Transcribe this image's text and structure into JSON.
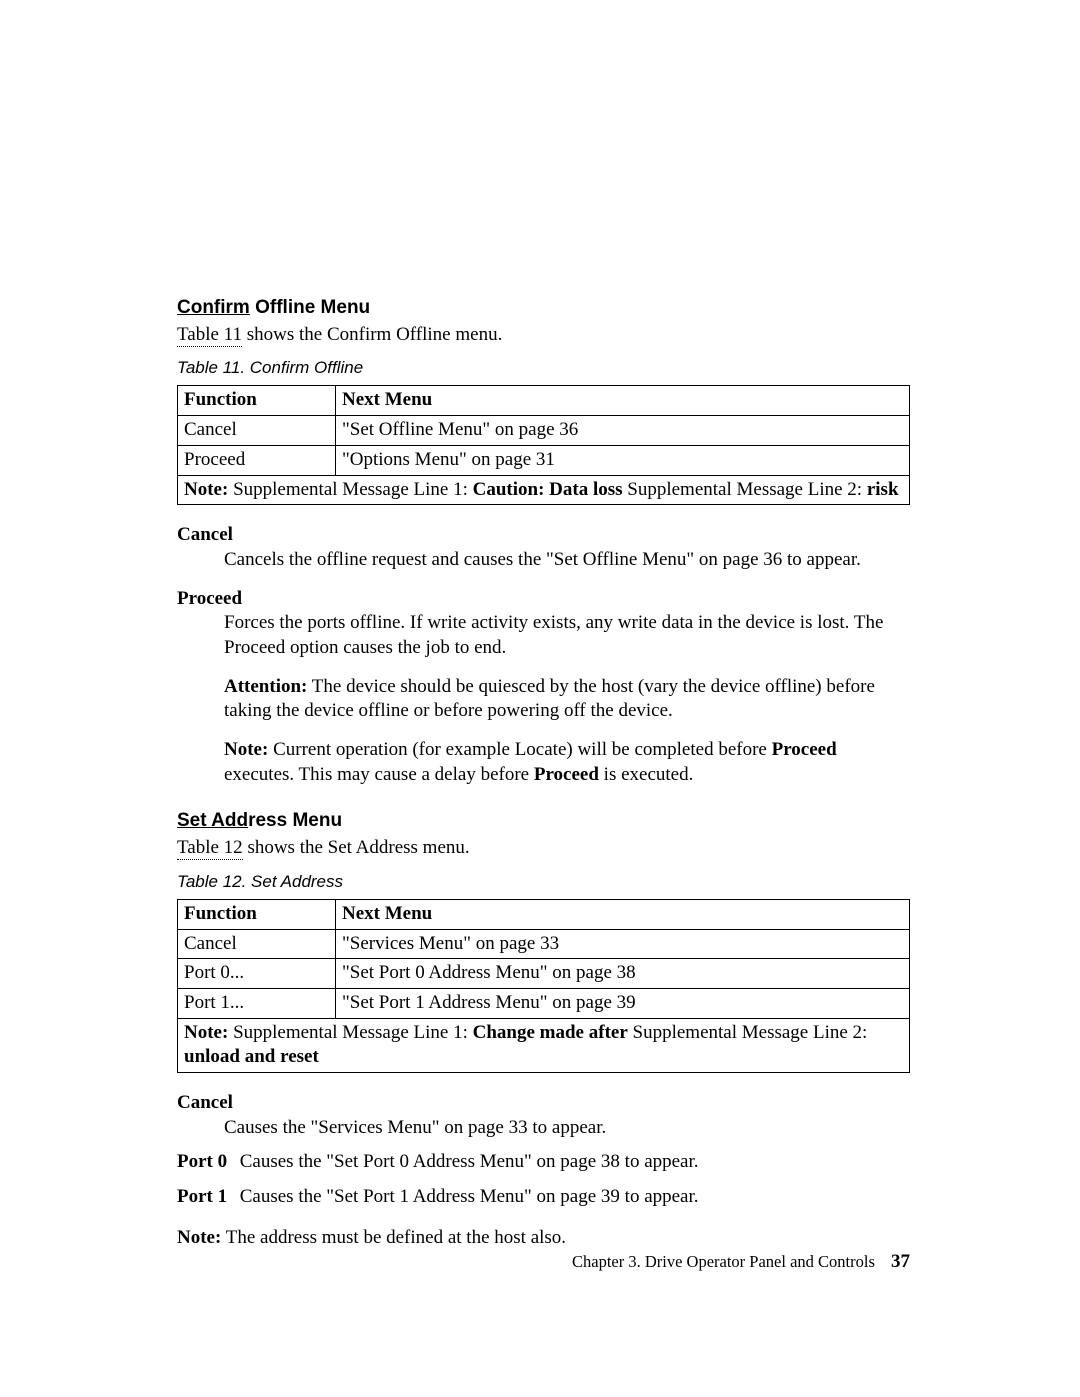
{
  "section1": {
    "heading_underlined": "Confirm",
    "heading_rest": " Offline Menu",
    "intro_link": "Table 11",
    "intro_rest": " shows the Confirm Offline menu.",
    "caption": "Table 11. Confirm Offline",
    "th_function": "Function",
    "th_next": "Next Menu",
    "rows": [
      {
        "fn": "Cancel",
        "next": "\"Set Offline Menu\" on page 36"
      },
      {
        "fn": "Proceed",
        "next": "\"Options Menu\" on page 31"
      }
    ],
    "note_lead": "Note:",
    "note_mid1": " Supplemental Message Line 1: ",
    "note_bold1": "Caution: Data loss",
    "note_mid2": " Supplemental Message Line 2: ",
    "note_bold2": "risk",
    "cancel_term": "Cancel",
    "cancel_def": "Cancels the offline request and causes the \"Set Offline Menu\" on page 36 to appear.",
    "proceed_term": "Proceed",
    "proceed_p1": "Forces the ports offline. If write activity exists, any write data in the device is lost. The Proceed option causes the job to end.",
    "proceed_attn_lead": "Attention:",
    "proceed_attn_rest": " The device should be quiesced by the host (vary the device offline) before taking the device offline or before powering off the device.",
    "proceed_note_lead": "Note:",
    "proceed_note_1": " Current operation (for example Locate) will be completed before ",
    "proceed_note_b1": "Proceed",
    "proceed_note_2": " executes. This may cause a delay before ",
    "proceed_note_b2": "Proceed",
    "proceed_note_3": " is executed."
  },
  "section2": {
    "heading_underlined": "Set Add",
    "heading_rest": "ress Menu",
    "intro_link": "Table 12",
    "intro_rest": " shows the Set Address menu.",
    "caption": "Table 12. Set Address",
    "th_function": "Function",
    "th_next": "Next Menu",
    "rows": [
      {
        "fn": "Cancel",
        "next": "\"Services Menu\" on page 33"
      },
      {
        "fn": "Port 0...",
        "next": "\"Set Port 0 Address Menu\" on page 38"
      },
      {
        "fn": "Port 1...",
        "next": "\"Set Port 1 Address Menu\" on page 39"
      }
    ],
    "note_lead": "Note:",
    "note_mid1": " Supplemental Message Line 1: ",
    "note_bold1": "Change made after",
    "note_mid2": " Supplemental Message Line 2: ",
    "note_bold2": "unload and reset",
    "cancel_term": "Cancel",
    "cancel_def": "Causes the \"Services Menu\" on page 33 to appear.",
    "port0_term": "Port 0",
    "port0_def": "Causes the \"Set Port 0 Address Menu\" on page 38 to appear.",
    "port1_term": "Port 1",
    "port1_def": "Causes the \"Set Port 1 Address Menu\" on page 39 to appear.",
    "final_note_lead": "Note:",
    "final_note_rest": " The address must be defined at the host also."
  },
  "footer": {
    "chapter": "Chapter 3. Drive Operator Panel and Controls",
    "page": "37"
  }
}
